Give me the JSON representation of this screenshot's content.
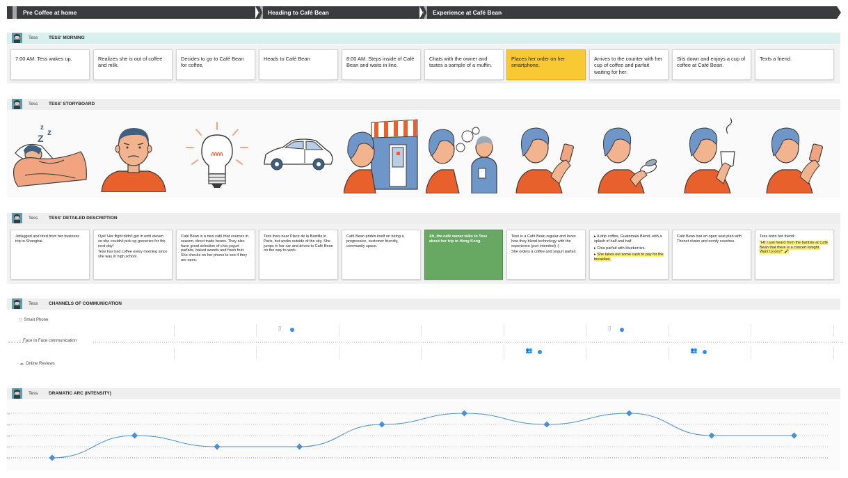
{
  "phases": [
    {
      "label": "Pre Coffee at home"
    },
    {
      "label": "Heading to Café Bean"
    },
    {
      "label": "Experience at Café Bean"
    }
  ],
  "persona": "Tess",
  "sections": {
    "morning": "TESS' MORNING",
    "storyboard": "TESS' STORYBOARD",
    "detailed": "TESS' DETAILED DESCRIPTION",
    "channels": "CHANNELS OF COMMUNICATION",
    "arc": "DRAMATIC ARC (INTENSITY)"
  },
  "morning_steps": [
    "7:00 AM. Tess wakes up.",
    "Realizes she is out of coffee and milk.",
    "Decides to go to Café Bean for coffee.",
    "Heads to Café Bean",
    "8:00 AM. Steps inside of Café Bean and waits in line.",
    "Chats with the owner and tastes a sample of a muffin.",
    "Places her order on her smartphone.",
    "Arrives to the counter with her cup of coffee and parfait waiting for her.",
    "Sits down and enjoys a cup of coffee at Café Bean.",
    "Texts a friend."
  ],
  "storyboard": [
    {
      "icon": "sleeping-person-icon"
    },
    {
      "icon": "worried-man-icon"
    },
    {
      "icon": "lightbulb-icon"
    },
    {
      "icon": "car-icon"
    },
    {
      "icon": "cafe-storefront-icon"
    },
    {
      "icon": "chatting-owner-icon"
    },
    {
      "icon": "ordering-phone-icon"
    },
    {
      "icon": "receiving-order-icon"
    },
    {
      "icon": "drinking-coffee-icon"
    },
    {
      "icon": "texting-friend-icon"
    }
  ],
  "details": [
    {
      "p": [
        "Jetlagged and tired from her business trip to Shanghai."
      ]
    },
    {
      "p": [
        "Oye! Her flight didn't get in until eleven so she couldn't pick up groceries for the next day!",
        "Tess has had coffee every morning since she was in high school."
      ]
    },
    {
      "p": [
        "Café Bean is a new café that sources in season, direct trade beans. They also have great selection of chia yogurt parfaits, baked sweets and fresh fruit. She checks on her phone to see if they are open."
      ]
    },
    {
      "p": [
        "Tess lives near Place de la Bastille in Paris, but works outside of the city. She jumps in her car and drives to Café Bean on the way to work."
      ]
    },
    {
      "p": [
        "Café Bean prides itself on being a progressive, customer friendly, community space."
      ]
    },
    {
      "p": [
        "Ah, the café owner talks to Tess about her trip to Hong Kong."
      ]
    },
    {
      "p": [
        "Tess is a Café Bean regular and loves how they blend technology with the experience (pun intended) :)",
        "She orders a coffee and yogurt parfait."
      ]
    },
    {
      "bullets": [
        "A drip coffee, Guatemala Blend, with a splash of half and half.",
        "Chia parfait with blueberries.",
        "She takes out some cash to pay for the breakfast."
      ]
    },
    {
      "p": [
        "Café Bean has an open seat plan with Thonet chairs and comfy couches."
      ]
    },
    {
      "p": [
        "Tess texts her friend:",
        "\"Hi! I just heard from the bartiste at Café Bean that there is a concert tonight. Want to join?\" 🎤"
      ]
    }
  ],
  "channels": {
    "rows": [
      {
        "label": "Smart Phone",
        "icon": "smartphone-icon"
      },
      {
        "label": "Face to Face communication",
        "icon": "people-icon"
      },
      {
        "label": "Online Reviews",
        "icon": "cloud-icon"
      }
    ],
    "marks": [
      {
        "row": 0,
        "col": 2,
        "icon": "smartphone-icon"
      },
      {
        "row": 0,
        "col": 6,
        "icon": "smartphone-icon"
      },
      {
        "row": 0,
        "col": 9,
        "icon": "smartphone-icon"
      },
      {
        "row": 1,
        "col": 5,
        "icon": "people-icon"
      },
      {
        "row": 1,
        "col": 7,
        "icon": "people-icon"
      }
    ]
  },
  "chart_data": {
    "type": "line",
    "x": [
      1,
      2,
      3,
      4,
      5,
      6,
      7,
      8,
      9,
      10
    ],
    "series": [
      {
        "values": [
          1,
          3,
          2,
          2,
          4,
          5,
          4,
          5,
          3,
          3
        ]
      }
    ],
    "ylim": [
      1,
      5
    ],
    "grid": true,
    "tick_labels": [
      "+5",
      "+4",
      "+3",
      "+2",
      "+1"
    ]
  },
  "colors": {
    "phase_bar": "#393b3f",
    "morning_header": "#daf0ee",
    "section_header": "#eeeeee",
    "highlight_card": "#f8c933",
    "green_card": "#67a962",
    "accent_blue": "#3a8dde",
    "line_blue": "#4a90c8",
    "illustration_orange": "#e8612c",
    "illustration_blue": "#6f96c8"
  }
}
